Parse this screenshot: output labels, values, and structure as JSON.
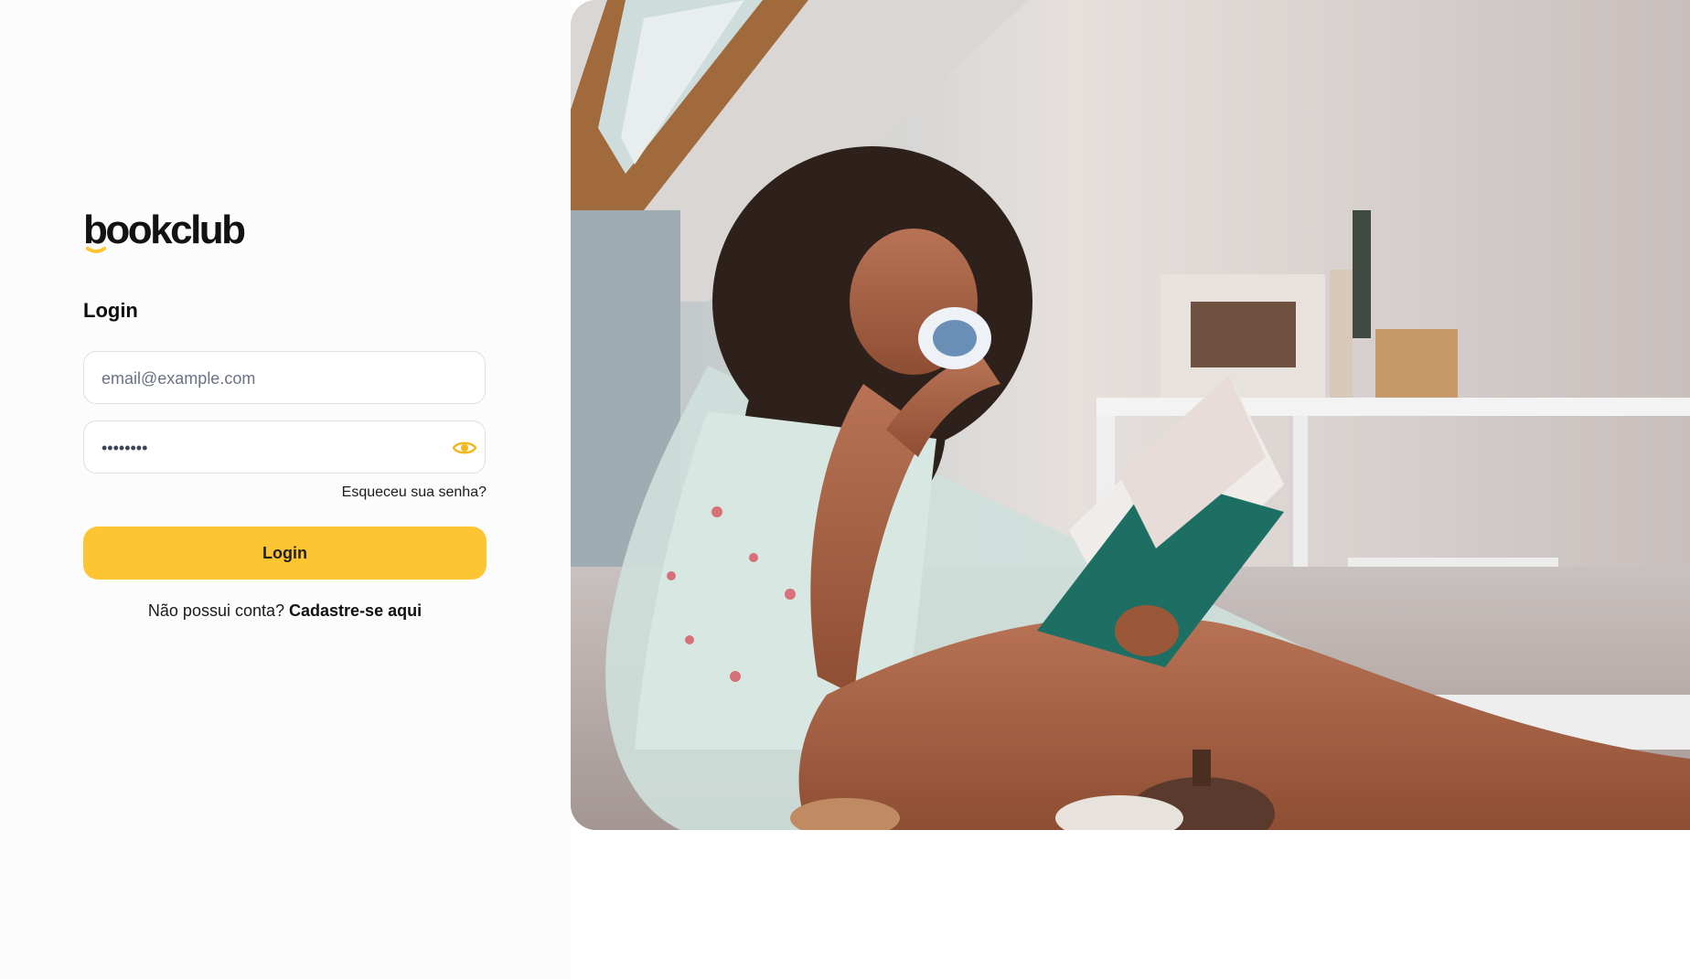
{
  "brand": {
    "logo_text": "bookclub",
    "accent_color": "#fec532"
  },
  "login_form": {
    "heading": "Login",
    "email_placeholder": "email@example.com",
    "password_value": "********",
    "password_toggle_icon": "eye-icon",
    "forgot_password_label": "Esqueceu sua senha?",
    "submit_label": "Login",
    "signup_prompt": "Não possui conta?",
    "signup_link_label": "Cadastre-se aqui"
  },
  "hero_image": {
    "icon": "photo-woman-reading-book-with-mug"
  }
}
